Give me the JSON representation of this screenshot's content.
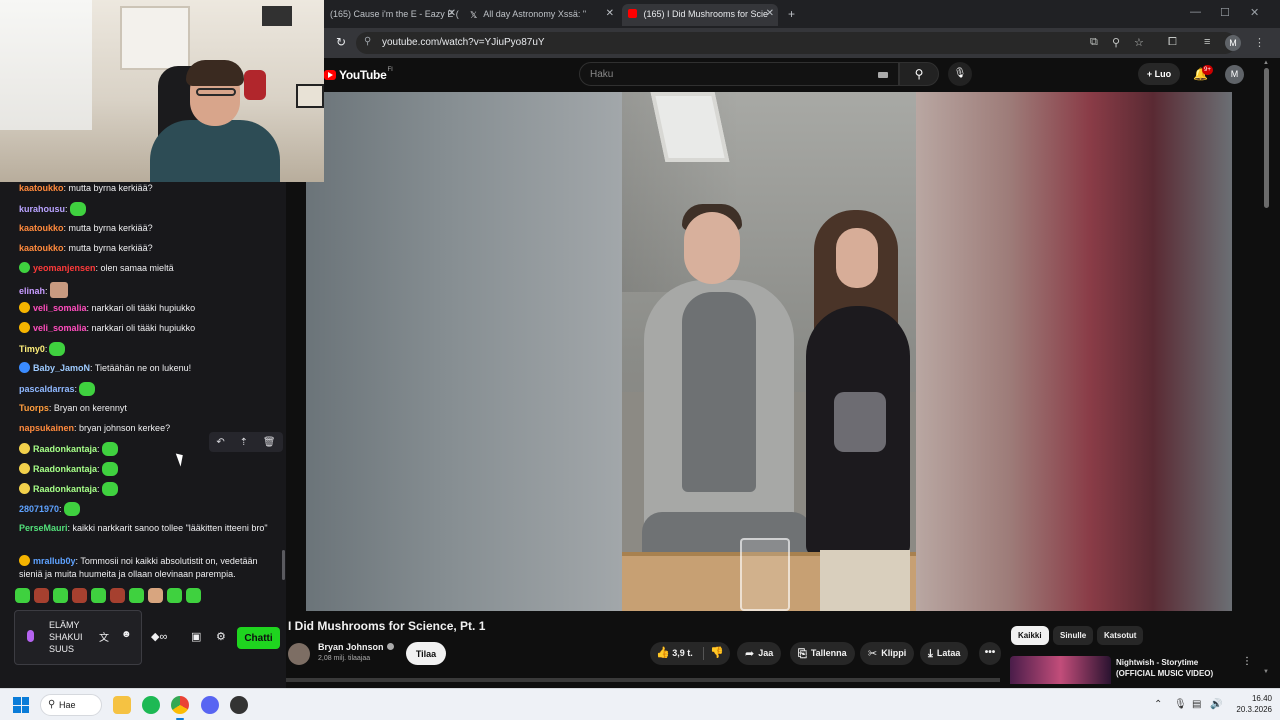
{
  "browser": {
    "tabs": [
      {
        "title": "(165) Cause i'm the E - Eazy E (",
        "active": false
      },
      {
        "title": "All day Astronomy Xssä: \"",
        "active": false
      },
      {
        "title": "(165) I Did Mushrooms for Scie",
        "active": true
      }
    ],
    "new_tab": "+",
    "close": "✕",
    "url": "youtube.com/watch?v=YJiuPyo87uY"
  },
  "youtube": {
    "logo_text": "YouTube",
    "logo_region": "FI",
    "search_placeholder": "Haku",
    "create_label": "Luo",
    "notifications_badge": "9+",
    "avatar_initial": "M",
    "video_title": "I Did Mushrooms for Science, Pt. 1",
    "channel_name": "Bryan Johnson",
    "channel_subs": "2,08 milj. tilaajaa",
    "subscribe_label": "Tilaa",
    "like_count": "3,9 t.",
    "share_label": "Jaa",
    "save_label": "Tallenna",
    "clip_label": "Klippi",
    "download_label": "Lataa",
    "more_label": "•••",
    "chips": [
      {
        "label": "Kaikki",
        "active": true
      },
      {
        "label": "Sinulle",
        "active": false
      },
      {
        "label": "Katsotut",
        "active": false
      }
    ],
    "recommendation": {
      "title": "Nightwish - Storytime (OFFICIAL MUSIC VIDEO)"
    }
  },
  "chat": {
    "messages": [
      {
        "user": "kaatoukko",
        "color": "#ff8a3d",
        "text": ": mutta byrna kerkiää?",
        "badge": "",
        "emote": ""
      },
      {
        "user": "kurahousu",
        "color": "#b9a3ff",
        "text": ":",
        "badge": "",
        "emote": "green"
      },
      {
        "user": "kaatoukko",
        "color": "#ff8a3d",
        "text": ": mutta byrna kerkiää?",
        "badge": "",
        "emote": ""
      },
      {
        "user": "kaatoukko",
        "color": "#ff8a3d",
        "text": ": mutta byrna kerkiää?",
        "badge": "",
        "emote": ""
      },
      {
        "user": "yeomanjensen",
        "color": "#ff3a3a",
        "text": ": olen samaa mieltä",
        "badge": "green",
        "emote": ""
      },
      {
        "user": "elinah",
        "color": "#c79bff",
        "text": ":",
        "badge": "",
        "emote": "face"
      },
      {
        "user": "veli_somalia",
        "color": "#ff4dbd",
        "text": ": narkkari oli tääki hupiukko",
        "badge": "gold",
        "emote": ""
      },
      {
        "user": "veli_somalia",
        "color": "#ff4dbd",
        "text": ": narkkari oli tääki hupiukko",
        "badge": "gold",
        "emote": ""
      },
      {
        "user": "Timy0",
        "color": "#fff07a",
        "text": ":",
        "badge": "",
        "emote": "green"
      },
      {
        "user": "Baby_JamoN",
        "color": "#9ecbff",
        "text": ": Tietäähän ne on lukenu!",
        "badge": "blue",
        "emote": ""
      },
      {
        "user": "pascaldarras",
        "color": "#8fb8ff",
        "text": ":",
        "badge": "",
        "emote": "green"
      },
      {
        "user": "Tuorps",
        "color": "#ff9d3d",
        "text": ": Bryan on kerennyt",
        "badge": "",
        "emote": ""
      },
      {
        "user": "napsukainen",
        "color": "#ff8a3d",
        "text": ": bryan johnson kerkee?",
        "badge": "",
        "emote": ""
      },
      {
        "user": "Raadonkantaja",
        "color": "#a6ff88",
        "text": ":",
        "badge": "yellow",
        "emote": "green"
      },
      {
        "user": "Raadonkantaja",
        "color": "#a6ff88",
        "text": ":",
        "badge": "yellow",
        "emote": "green"
      },
      {
        "user": "Raadonkantaja",
        "color": "#a6ff88",
        "text": ":",
        "badge": "yellow",
        "emote": "green"
      },
      {
        "user": "28071970",
        "color": "#5ea2ff",
        "text": ":",
        "badge": "",
        "emote": "green"
      },
      {
        "user": "PerseMauri",
        "color": "#52e07a",
        "text": ": kaikki narkkarit sanoo tollee \"lääkitten itteeni bro\"",
        "badge": "",
        "emote": ""
      },
      {
        "user": "mrallub0y",
        "color": "#5ea2ff",
        "text": ": Tommosii noi kaikki absolutistit on, vedetään sieniä ja muita huumeita ja ollaan olevinaan parempia.",
        "badge": "crown",
        "emote": ""
      }
    ],
    "actions": {
      "reply": "↶",
      "pin": "⇡",
      "delete": "🗑"
    },
    "input_text": "ELÄMY SHAKUI SUUS",
    "send_label": "Chatti"
  },
  "taskbar": {
    "search_label": "Hae",
    "time": "16.40",
    "date": "20.3.2026"
  },
  "colors": {
    "twitch_green": "#1fd41f",
    "youtube_red": "#ff0000",
    "browser_bg": "#202124"
  }
}
